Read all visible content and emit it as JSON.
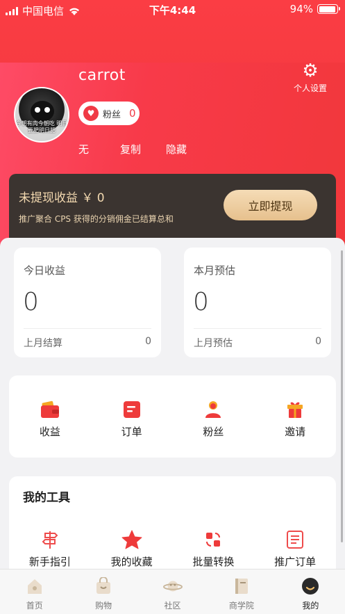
{
  "status_bar": {
    "carrier": "中国电信",
    "time": "下午4:44",
    "battery": "94%"
  },
  "profile": {
    "username": "carrot",
    "avatar_caption": "今朝有肉今朝吃 明日要肥明日肥",
    "fans_label": "粉丝",
    "fans_count": "0",
    "actions": [
      "无",
      "复制",
      "隐藏"
    ],
    "settings_label": "个人设置",
    "settings_icon": "gear-icon"
  },
  "earnings_banner": {
    "title": "未提现收益 ￥  0",
    "subtitle": "推广聚合 CPS 获得的分销佣金已结算总和",
    "button_label": "立即提现"
  },
  "stats": [
    {
      "label": "今日收益",
      "value": "0",
      "foot_label": "上月结算",
      "foot_value": "0"
    },
    {
      "label": "本月预估",
      "value": "0",
      "foot_label": "上月预估",
      "foot_value": "0"
    }
  ],
  "quick_menu": [
    {
      "label": "收益",
      "icon": "wallet-icon"
    },
    {
      "label": "订单",
      "icon": "order-icon"
    },
    {
      "label": "粉丝",
      "icon": "fans-icon"
    },
    {
      "label": "邀请",
      "icon": "gift-icon"
    }
  ],
  "tools": {
    "title": "我的工具",
    "items": [
      {
        "label": "新手指引",
        "icon": "signpost-icon"
      },
      {
        "label": "我的收藏",
        "icon": "star-icon"
      },
      {
        "label": "批量转换",
        "icon": "convert-icon"
      },
      {
        "label": "推广订单",
        "icon": "document-icon"
      }
    ]
  },
  "tab_bar": [
    {
      "label": "首页",
      "icon": "home-icon",
      "active": false
    },
    {
      "label": "购物",
      "icon": "shopping-bag-icon",
      "active": false
    },
    {
      "label": "社区",
      "icon": "planet-icon",
      "active": false
    },
    {
      "label": "商学院",
      "icon": "book-icon",
      "active": false
    },
    {
      "label": "我的",
      "icon": "profile-icon",
      "active": true
    }
  ],
  "colors": {
    "brand_red": "#f03a45",
    "banner_dark": "#3b3430",
    "gold": "#e6c08d",
    "background": "#f2f2f4"
  }
}
